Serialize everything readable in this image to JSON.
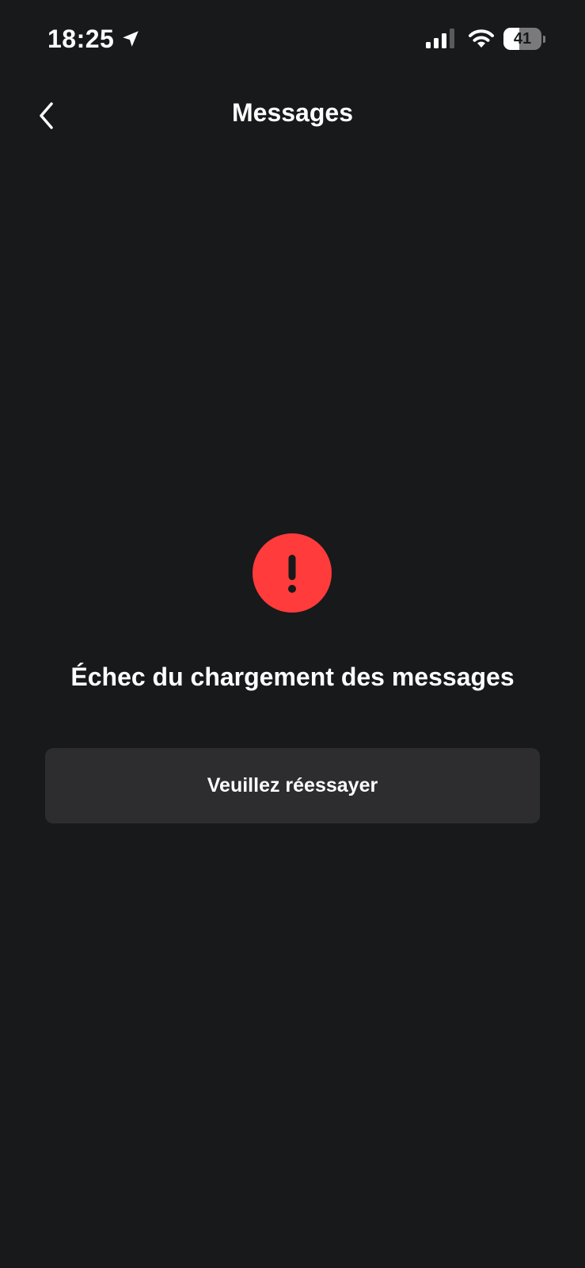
{
  "status_bar": {
    "time": "18:25",
    "battery_level": "41",
    "battery_fraction": 0.41,
    "icons": [
      "location-arrow-icon",
      "cellular-signal-icon",
      "wifi-icon",
      "battery-icon"
    ]
  },
  "header": {
    "title": "Messages",
    "back_icon": "chevron-left-icon"
  },
  "error": {
    "icon": "exclamation-icon",
    "icon_color": "#ff3b3b",
    "message": "Échec du chargement des messages"
  },
  "retry_button": {
    "label": "Veuillez réessayer"
  },
  "colors": {
    "background": "#18191b",
    "button_background": "#2d2d2f",
    "text": "#ffffff"
  }
}
